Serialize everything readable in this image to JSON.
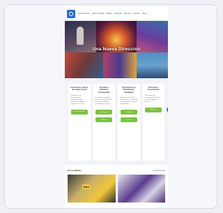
{
  "nav": {
    "items": [
      "Quiénes Somos",
      "Nuestro Trabajo",
      "Noticias",
      "Involúcrate",
      "Recursos",
      "Contacto",
      "Donar"
    ]
  },
  "hero": {
    "title": "Una Nueva Dirección"
  },
  "features": [
    {
      "title": "Conectamos Líderes de Cambio Social",
      "body": "Trabajamos con organizaciones comunitarias para fortalecer su trabajo y amplificar sus voces.",
      "buttons": [
        "Más Información"
      ]
    },
    {
      "title": "Apoyamos Iniciativas Comunitarias",
      "body": "Financiamos proyectos que promueven la justicia social y el desarrollo sostenible en la región.",
      "buttons": [
        "Ver Proyectos",
        "Aplicar"
      ]
    },
    {
      "title": "Promovemos la Participación Ciudadana",
      "body": "Creamos espacios de diálogo y acción colectiva para transformar nuestras comunidades.",
      "buttons": [
        "Participa",
        "Eventos"
      ]
    },
    {
      "title": "Generamos Conocimiento",
      "body": "Investigamos y compartimos recursos para el aprendizaje colectivo.",
      "buttons": [
        "Recursos"
      ]
    }
  ],
  "help": {
    "icon": "help-icon",
    "glyph": "?"
  },
  "news": {
    "title": "En Los Medios",
    "link": "Ver Más Noticias",
    "card_label": "NAC"
  },
  "colors": {
    "brand": "#2b6fc1",
    "button": "#7cc142",
    "help": "#3b6fd6"
  }
}
